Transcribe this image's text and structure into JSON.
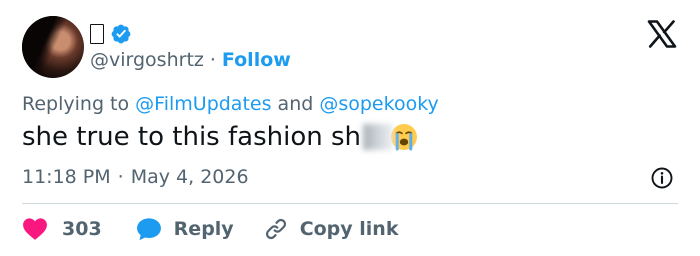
{
  "author": {
    "display_name": "▯",
    "handle": "@virgoshrtz",
    "separator": "·",
    "follow_label": "Follow"
  },
  "replying": {
    "prefix": "Replying to",
    "mention_1": "@FilmUpdates",
    "conjunction": "and",
    "mention_2": "@sopekooky"
  },
  "tweet": {
    "text": "she true to this fashion sh"
  },
  "meta": {
    "time": "11:18 PM",
    "separator": "·",
    "date": "May 4, 2026"
  },
  "actions": {
    "like_count": "303",
    "reply_label": "Reply",
    "copy_label": "Copy link"
  },
  "icons": {
    "verified": "verified-badge-icon",
    "logo": "x-logo-icon",
    "info": "info-icon",
    "like": "heart-icon",
    "reply": "reply-bubble-icon",
    "copy": "link-icon",
    "emoji": "loudly-crying-face-emoji"
  },
  "colors": {
    "accent": "#1d9bf0",
    "text": "#0f1419",
    "muted": "#536471",
    "like": "#f91880",
    "divider": "#cfd9de"
  }
}
